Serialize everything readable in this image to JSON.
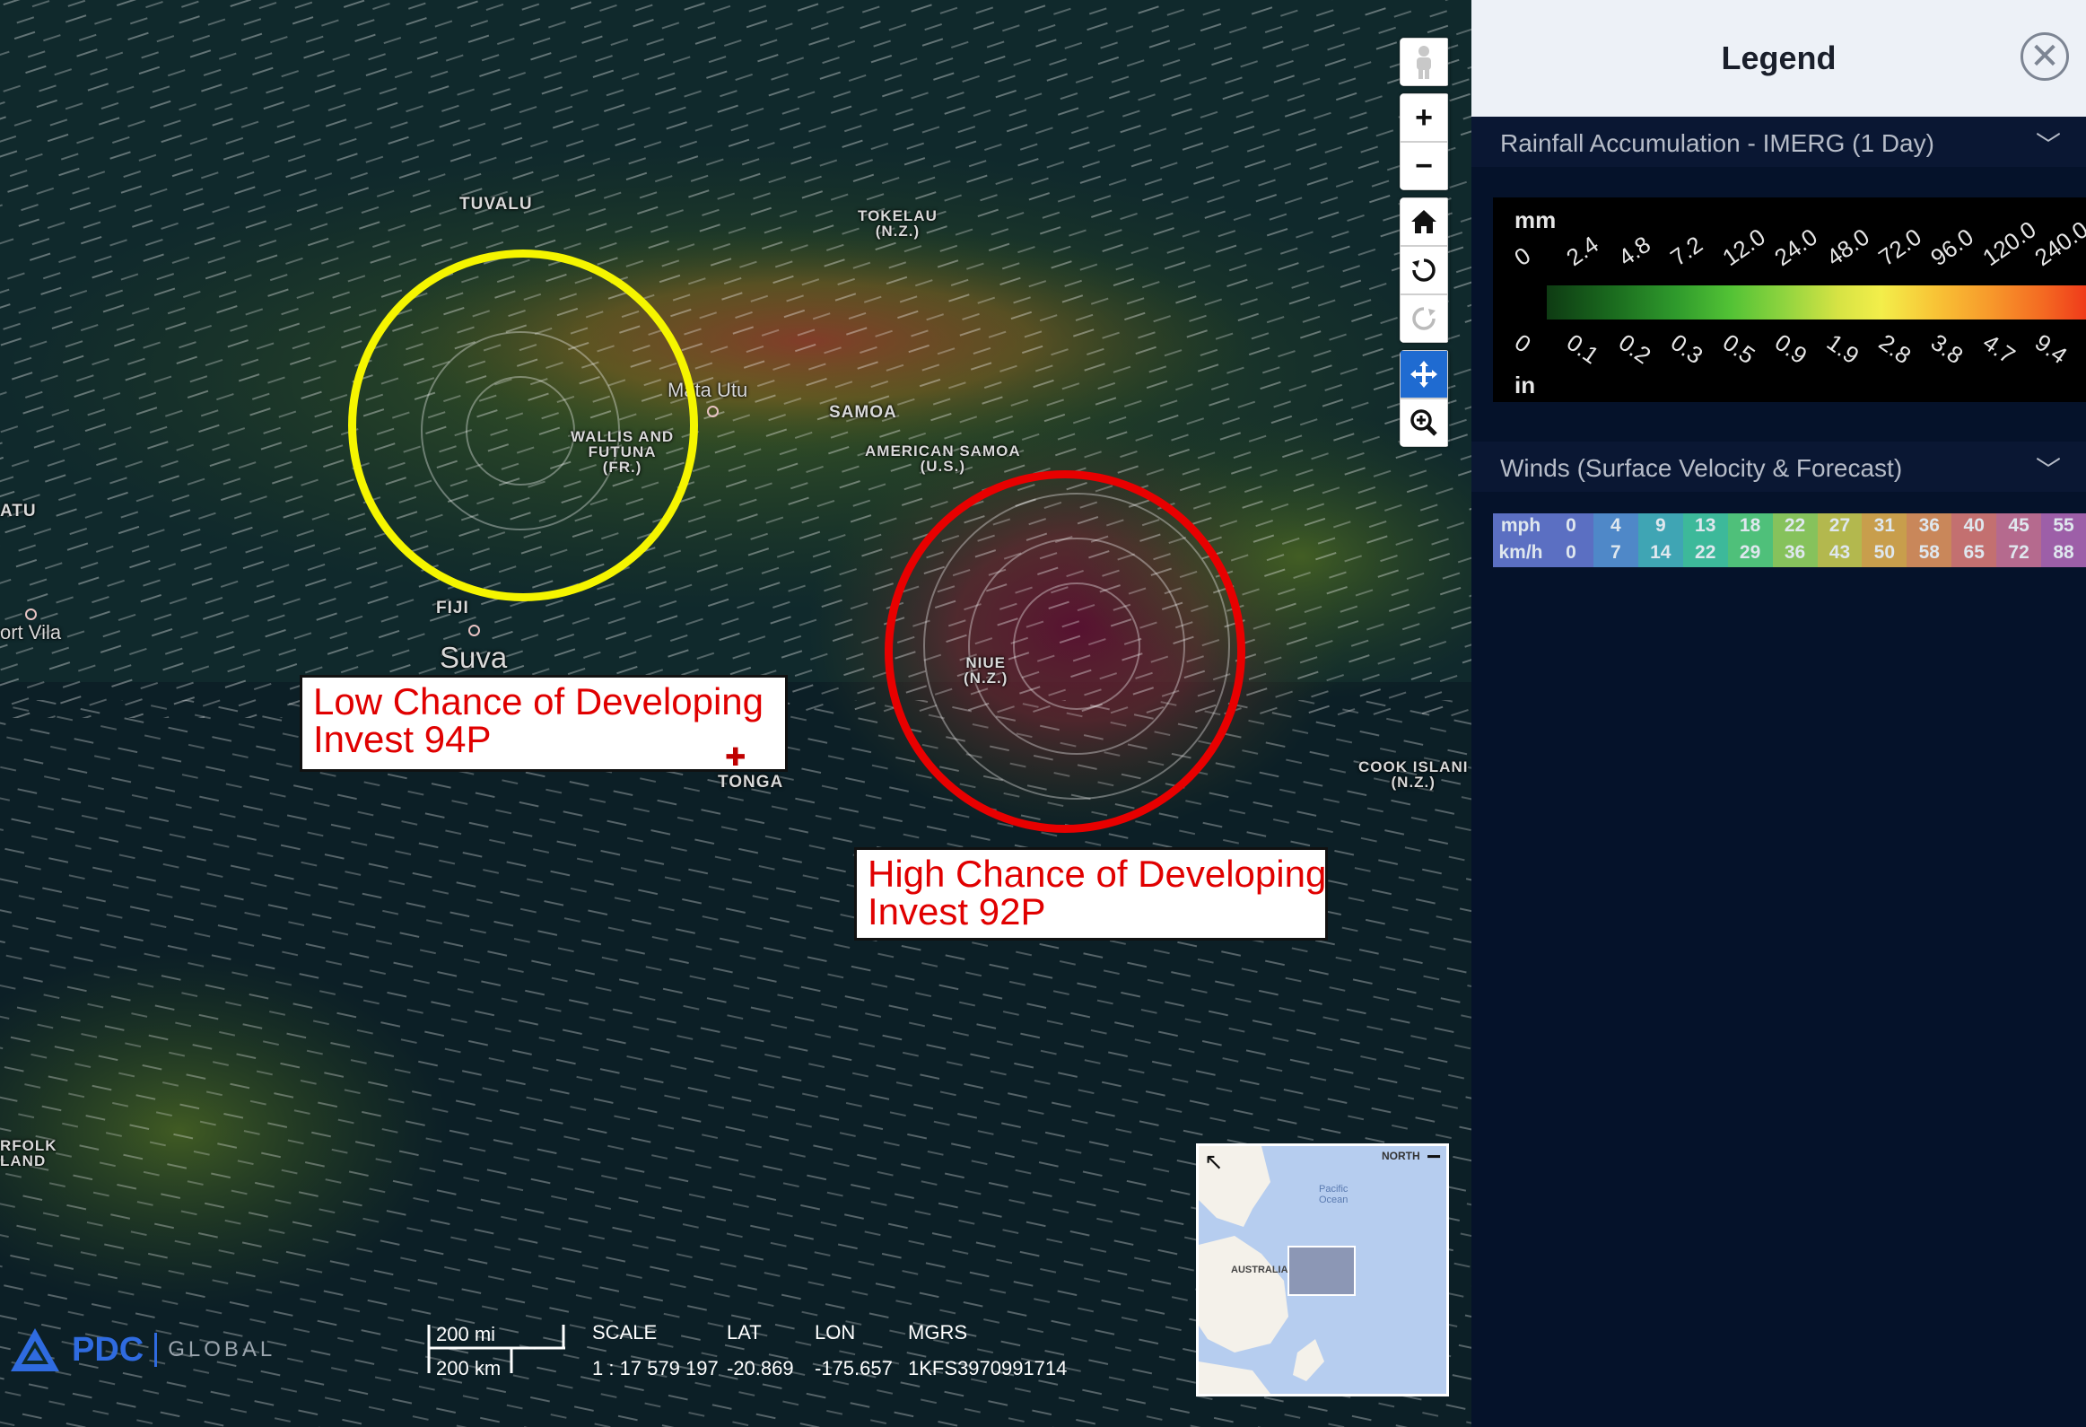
{
  "map": {
    "places": [
      {
        "name": "TUVALU"
      },
      {
        "name": "TOKELAU\n(N.Z.)"
      },
      {
        "name": "Mata Utu"
      },
      {
        "name": "WALLIS AND\nFUTUNA\n(FR.)"
      },
      {
        "name": "SAMOA"
      },
      {
        "name": "AMERICAN SAMOA\n(U.S.)"
      },
      {
        "name": "ATU"
      },
      {
        "name": "FIJI"
      },
      {
        "name": "Suva"
      },
      {
        "name": "ort Vila"
      },
      {
        "name": "NIUE\n(N.Z.)"
      },
      {
        "name": "TONGA"
      },
      {
        "name": "COOK ISLANI\n(N.Z.)"
      },
      {
        "name": "RFOLK\nLAND"
      }
    ],
    "annotations": {
      "low": {
        "line1": "Low Chance of Developing",
        "line2": "Invest 94P",
        "circle_color": "#f5f500"
      },
      "high": {
        "line1": "High Chance of Developing",
        "line2": "Invest 92P",
        "circle_color": "#e80000"
      }
    },
    "toolbar": {
      "street_view_icon": "person-icon",
      "zoom_in": "+",
      "zoom_out": "−",
      "home_icon": "home-icon",
      "rotate_left_icon": "rotate-ccw-icon",
      "rotate_right_icon": "rotate-cw-icon",
      "pan_icon": "move-icon",
      "zoom_box_icon": "zoom-icon"
    },
    "scale_bar": {
      "mi": "200 mi",
      "km": "200 km"
    },
    "status": {
      "scale_label": "SCALE",
      "scale_value": "1 : 17 579 197",
      "lat_label": "LAT",
      "lat_value": "-20.869",
      "lon_label": "LON",
      "lon_value": "-175.657",
      "mgrs_label": "MGRS",
      "mgrs_value": "1KFS3970991714"
    },
    "logo": {
      "brand": "PDC",
      "product": "GLOBAL"
    },
    "minimap": {
      "north": "NORTH",
      "ocean": "Pacific\nOcean",
      "land": "AUSTRALIA",
      "collapse": "−",
      "expand_icon": "arrow-expand-icon"
    }
  },
  "legend": {
    "title": "Legend",
    "close_icon": "close-icon",
    "rainfall": {
      "title": "Rainfall Accumulation - IMERG (1 Day)",
      "unit_top": "mm",
      "unit_bottom": "in",
      "mm_ticks": [
        "0",
        "2.4",
        "4.8",
        "7.2",
        "12.0",
        "24.0",
        "48.0",
        "72.0",
        "96.0",
        "120.0",
        "240.0"
      ],
      "in_ticks": [
        "0",
        "0.1",
        "0.2",
        "0.3",
        "0.5",
        "0.9",
        "1.9",
        "2.8",
        "3.8",
        "4.7",
        "9.4"
      ]
    },
    "winds": {
      "title": "Winds (Surface Velocity & Forecast)",
      "mph_label": "mph",
      "kmh_label": "km/h",
      "mph": [
        "0",
        "4",
        "9",
        "13",
        "18",
        "22",
        "27",
        "31",
        "36",
        "40",
        "45",
        "55"
      ],
      "kmh": [
        "0",
        "7",
        "14",
        "22",
        "29",
        "36",
        "43",
        "50",
        "58",
        "65",
        "72",
        "88"
      ],
      "colors": [
        "#5b6fc2",
        "#4f88c8",
        "#3fa5b4",
        "#3db99a",
        "#4fc07a",
        "#86c25c",
        "#b3b84e",
        "#c89e4c",
        "#c9875a",
        "#c37070",
        "#b56a8e",
        "#9d5fa8"
      ]
    }
  }
}
